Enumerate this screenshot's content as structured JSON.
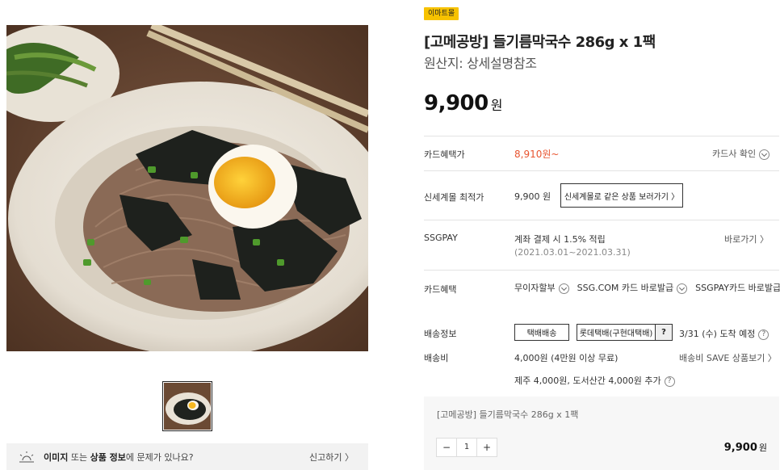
{
  "badge": "이마트몰",
  "product": {
    "title": "[고메공방] 들기름막국수 286g x 1팩",
    "origin": "원산지: 상세설명참조",
    "price": "9,900",
    "price_unit": "원"
  },
  "rows": {
    "card_discount": {
      "label": "카드혜택가",
      "value": "8,910원~",
      "link": "카드사 확인"
    },
    "lowest_price": {
      "label": "신세계몰 최적가",
      "value": "9,900 원",
      "button": "신세계몰로 같은 상품 보러가기 〉"
    },
    "ssgpay": {
      "label": "SSGPAY",
      "value": "계좌 결제 시 1.5% 적립",
      "period": "(2021.03.01~2021.03.31)",
      "link": "바로가기 〉"
    },
    "card_benefit": {
      "label": "카드혜택",
      "items": [
        "무이자할부",
        "SSG.COM 카드 바로발급",
        "SSGPAY카드 바로발급"
      ]
    },
    "shipping_info": {
      "label": "배송정보",
      "btn1": "택배배송",
      "btn2": "롯데택배(구현대택배)",
      "btn2_q": "?",
      "eta": "3/31 (수) 도착 예정"
    },
    "shipping_fee": {
      "label": "배송비",
      "value": "4,000원 (4만원 이상 무료)",
      "link": "배송비 SAVE 상품보기 〉",
      "extra": "제주 4,000원, 도서산간 4,000원 추가"
    }
  },
  "summary": {
    "name": "[고메공방] 들기름막국수 286g x 1팩",
    "minus": "−",
    "qty": "1",
    "plus": "+",
    "price": "9,900",
    "unit": "원"
  },
  "report": {
    "text_pre": "이미지",
    "text_mid1": " 또는 ",
    "text_bold": "상품 정보",
    "text_post": "에 문제가 있나요?",
    "link": "신고하기 〉"
  },
  "icons": {
    "main_image": "buckwheat-noodle-bowl-image",
    "thumbnail": "buckwheat-noodle-bowl-thumbnail",
    "report": "lightbulb-icon"
  },
  "colors": {
    "badge": "#f7c200",
    "discount": "#e8542f"
  }
}
